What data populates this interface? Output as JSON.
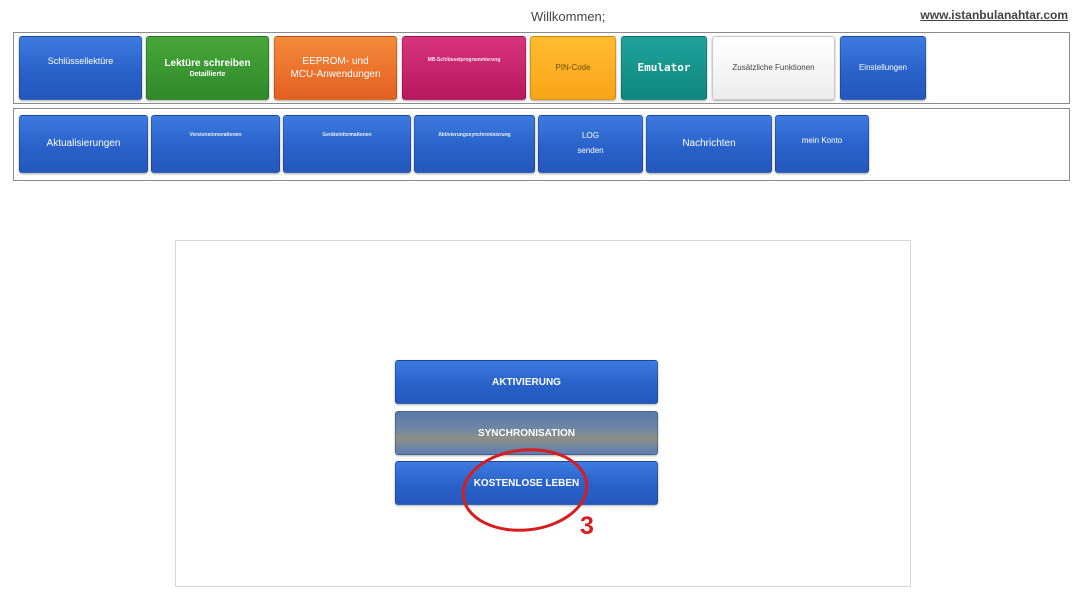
{
  "header": {
    "welcome": "Willkommen;",
    "site": "www.istanbulanahtar.com"
  },
  "menu_row1": [
    {
      "label": "Schlüssellektüre",
      "sub": ""
    },
    {
      "label": "Lektüre schreiben",
      "sub": "Detaillierte"
    },
    {
      "label": "EEPROM- und",
      "sub": "MCU-Anwendungen"
    },
    {
      "label": "MB-Schlüsselprogrammierung",
      "sub": ""
    },
    {
      "label": "PIN-Code",
      "sub": ""
    },
    {
      "label": "Emulator",
      "sub": ""
    },
    {
      "label": "Zusätzliche Funktionen",
      "sub": ""
    },
    {
      "label": "Einstellungen",
      "sub": ""
    }
  ],
  "menu_row2": [
    {
      "label": "Aktualisierungen",
      "sub": ""
    },
    {
      "label": "Versionsinnovationen",
      "sub": ""
    },
    {
      "label": "Geräteinformationen",
      "sub": ""
    },
    {
      "label": "Aktivierungssynchronisierung",
      "sub": ""
    },
    {
      "label": "LOG",
      "sub": "senden"
    },
    {
      "label": "Nachrichten",
      "sub": ""
    },
    {
      "label": "mein Konto",
      "sub": ""
    }
  ],
  "panel": {
    "activation": "AKTIVIERUNG",
    "sync": "SYNCHRONISATION",
    "free_life": "KOSTENLOSE LEBEN"
  },
  "annotation": {
    "step": "3",
    "color": "#d71d1d"
  }
}
